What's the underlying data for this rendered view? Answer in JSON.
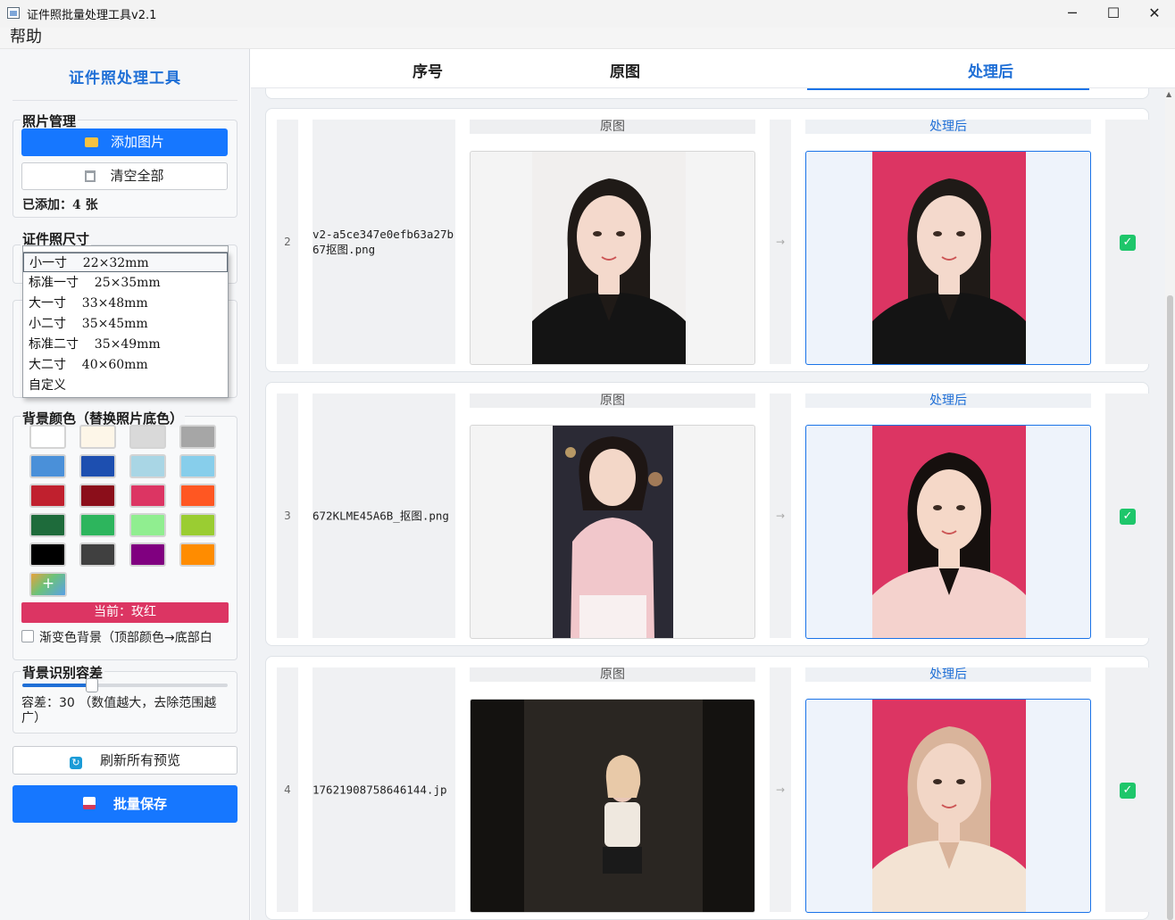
{
  "window": {
    "title": "证件照批量处理工具v2.1",
    "minimize": "─",
    "maximize": "☐",
    "close": "✕"
  },
  "menubar": {
    "help": "帮助"
  },
  "sidebar": {
    "title": "证件照处理工具",
    "photo_group": {
      "title": "照片管理",
      "add_button": "添加图片",
      "clear_button": "清空全部",
      "count_text": "已添加：4 张"
    },
    "size_group": {
      "title": "证件照尺寸",
      "options": [
        "小一寸    22×32mm",
        "标准一寸    25×35mm",
        "大一寸    33×48mm",
        "小二寸    35×45mm",
        "标准二寸    35×49mm",
        "大二寸    40×60mm",
        "自定义"
      ],
      "selected_index": 0
    },
    "color_group": {
      "title": "背景颜色（替换照片底色）",
      "swatches": [
        "#ffffff",
        "#fdf6e8",
        "#d9d9d9",
        "#a6a6a6",
        "#4a90d9",
        "#1d4fb0",
        "#a9d6e5",
        "#87ceeb",
        "#c0202e",
        "#8b0e1a",
        "#dc3563",
        "#ff5722",
        "#1e6b3b",
        "#2db55d",
        "#90ee90",
        "#9acd32",
        "#000000",
        "#404040",
        "#800080",
        "#ff8c00"
      ],
      "custom_label": "+",
      "current_label": "当前：玫红",
      "current_color": "#dc3563",
      "gradient_label": "渐变色背景（顶部颜色→底部白"
    },
    "tolerance_group": {
      "title": "背景识别容差",
      "value": 30,
      "max": 100,
      "text": "容差：30  （数值越大，去除范围越广）"
    },
    "refresh_button": "刷新所有预览",
    "save_button": "批量保存"
  },
  "table": {
    "headers": [
      "序号",
      "原图",
      "处理后"
    ],
    "orig_label": "原图",
    "proc_label": "处理后",
    "arrow": "→",
    "check": "✓",
    "rows": [
      {
        "index": "2",
        "filename": "v2-a5ce347e0efb63a27b67抠图.png",
        "checked": true
      },
      {
        "index": "3",
        "filename": "672KLME45A6B_抠图.png",
        "checked": true
      },
      {
        "index": "4",
        "filename": "17621908758646144.jp",
        "checked": true
      }
    ],
    "processed_background": "#dc3563"
  }
}
